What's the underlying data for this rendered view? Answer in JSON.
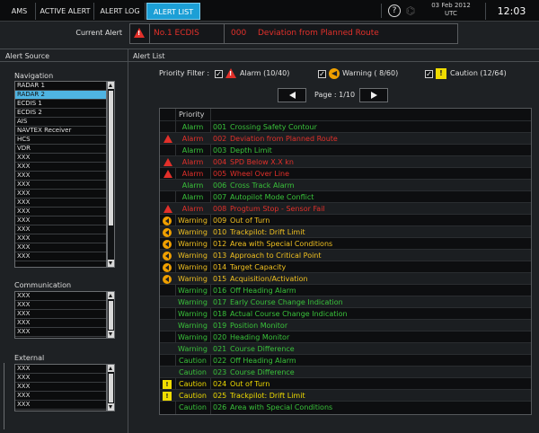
{
  "tabs": [
    {
      "label": "AMS",
      "active": false
    },
    {
      "label": "ACTIVE ALERT",
      "active": false
    },
    {
      "label": "ALERT LOG",
      "active": false
    },
    {
      "label": "ALERT LIST",
      "active": true
    }
  ],
  "clock": {
    "date": "03 Feb 2012",
    "zone": "UTC",
    "time": "12:03"
  },
  "help_glyph": "?",
  "current_alert": {
    "label": "Current Alert",
    "source": "No.1 ECDIS",
    "code": "000",
    "message": "Deviation from Planned Route"
  },
  "alert_source": {
    "title": "Alert Source",
    "navigation": {
      "label": "Navigation",
      "items": [
        "RADAR 1",
        "RADAR 2",
        "ECDIS 1",
        "ECDIS 2",
        "AIS",
        "NAVTEX Receiver",
        "HCS",
        "VDR",
        "XXX",
        "XXX",
        "XXX",
        "XXX",
        "XXX",
        "XXX",
        "XXX",
        "XXX",
        "XXX",
        "XXX",
        "XXX",
        "XXX"
      ],
      "selected": "RADAR 2"
    },
    "communication": {
      "label": "Communication",
      "items": [
        "XXX",
        "XXX",
        "XXX",
        "XXX",
        "XXX"
      ]
    },
    "external": {
      "label": "External",
      "items": [
        "XXX",
        "XXX",
        "XXX",
        "XXX",
        "XXX"
      ]
    }
  },
  "alert_list": {
    "title": "Alert List",
    "filter_label": "Priority Filter :",
    "filters": [
      {
        "label": "Alarm (10/40)",
        "checked": true,
        "icon": "alarm-triangle-icon"
      },
      {
        "label": "Warning ( 8/60)",
        "checked": true,
        "icon": "warning-circle-icon"
      },
      {
        "label": "Caution (12/64)",
        "checked": true,
        "icon": "caution-square-icon"
      }
    ],
    "page_label": "Page : 1/10",
    "column_priority": "Priority",
    "rows": [
      {
        "icon": "",
        "priority": "Alarm",
        "code": "001",
        "text": "Crossing Safety Contour",
        "state": "ack",
        "level": "alarm"
      },
      {
        "icon": "alarm",
        "priority": "Alarm",
        "code": "002",
        "text": "Deviation from Planned Route",
        "state": "active",
        "level": "alarm"
      },
      {
        "icon": "",
        "priority": "Alarm",
        "code": "003",
        "text": "Depth Limit",
        "state": "ack",
        "level": "alarm"
      },
      {
        "icon": "alarm",
        "priority": "Alarm",
        "code": "004",
        "text": "SPD Below X.X kn",
        "state": "active",
        "level": "alarm"
      },
      {
        "icon": "alarm",
        "priority": "Alarm",
        "code": "005",
        "text": "Wheel Over Line",
        "state": "active",
        "level": "alarm"
      },
      {
        "icon": "",
        "priority": "Alarm",
        "code": "006",
        "text": "Cross Track Alarm",
        "state": "ack",
        "level": "alarm"
      },
      {
        "icon": "",
        "priority": "Alarm",
        "code": "007",
        "text": "Autopilot Mode Conflict",
        "state": "ack",
        "level": "alarm"
      },
      {
        "icon": "alarm",
        "priority": "Alarm",
        "code": "008",
        "text": "Progtum Stop - Sensor Fail",
        "state": "active",
        "level": "alarm"
      },
      {
        "icon": "warning",
        "priority": "Warning",
        "code": "009",
        "text": "Out of Turn",
        "state": "active",
        "level": "warning"
      },
      {
        "icon": "warning",
        "priority": "Warning",
        "code": "010",
        "text": "Trackpilot: Drift Limit",
        "state": "active",
        "level": "warning"
      },
      {
        "icon": "warning",
        "priority": "Warning",
        "code": "012",
        "text": "Area with Special Conditions",
        "state": "active",
        "level": "warning"
      },
      {
        "icon": "warning",
        "priority": "Warning",
        "code": "013",
        "text": "Approach to Critical Point",
        "state": "active",
        "level": "warning"
      },
      {
        "icon": "warning",
        "priority": "Warning",
        "code": "014",
        "text": "Target Capacity",
        "state": "active",
        "level": "warning"
      },
      {
        "icon": "warning",
        "priority": "Warning",
        "code": "015",
        "text": "Acquisition/Activation",
        "state": "active",
        "level": "warning"
      },
      {
        "icon": "",
        "priority": "Warning",
        "code": "016",
        "text": "Off Heading Alarm",
        "state": "ack",
        "level": "warning"
      },
      {
        "icon": "",
        "priority": "Warning",
        "code": "017",
        "text": "Early Course Change Indication",
        "state": "ack",
        "level": "warning"
      },
      {
        "icon": "",
        "priority": "Warning",
        "code": "018",
        "text": "Actual Course Change Indication",
        "state": "ack",
        "level": "warning"
      },
      {
        "icon": "",
        "priority": "Warning",
        "code": "019",
        "text": "Position Monitor",
        "state": "ack",
        "level": "warning"
      },
      {
        "icon": "",
        "priority": "Warning",
        "code": "020",
        "text": "Heading Monitor",
        "state": "ack",
        "level": "warning"
      },
      {
        "icon": "",
        "priority": "Warning",
        "code": "021",
        "text": "Course Difference",
        "state": "ack",
        "level": "warning"
      },
      {
        "icon": "",
        "priority": "Caution",
        "code": "022",
        "text": "Off Heading Alarm",
        "state": "ack",
        "level": "caution"
      },
      {
        "icon": "",
        "priority": "Caution",
        "code": "023",
        "text": "Course Difference",
        "state": "ack",
        "level": "caution"
      },
      {
        "icon": "caution",
        "priority": "Caution",
        "code": "024",
        "text": "Out of Turn",
        "state": "active",
        "level": "caution"
      },
      {
        "icon": "caution",
        "priority": "Caution",
        "code": "025",
        "text": "Trackpilot: Drift Limit",
        "state": "active",
        "level": "caution"
      },
      {
        "icon": "",
        "priority": "Caution",
        "code": "026",
        "text": "Area with Special Conditions",
        "state": "ack",
        "level": "caution"
      }
    ]
  },
  "colors": {
    "accent": "#1c9fd6",
    "alarm": "#e2302a",
    "warning": "#f0a000",
    "caution": "#f0dc00",
    "acknowledged": "#39c23a"
  }
}
